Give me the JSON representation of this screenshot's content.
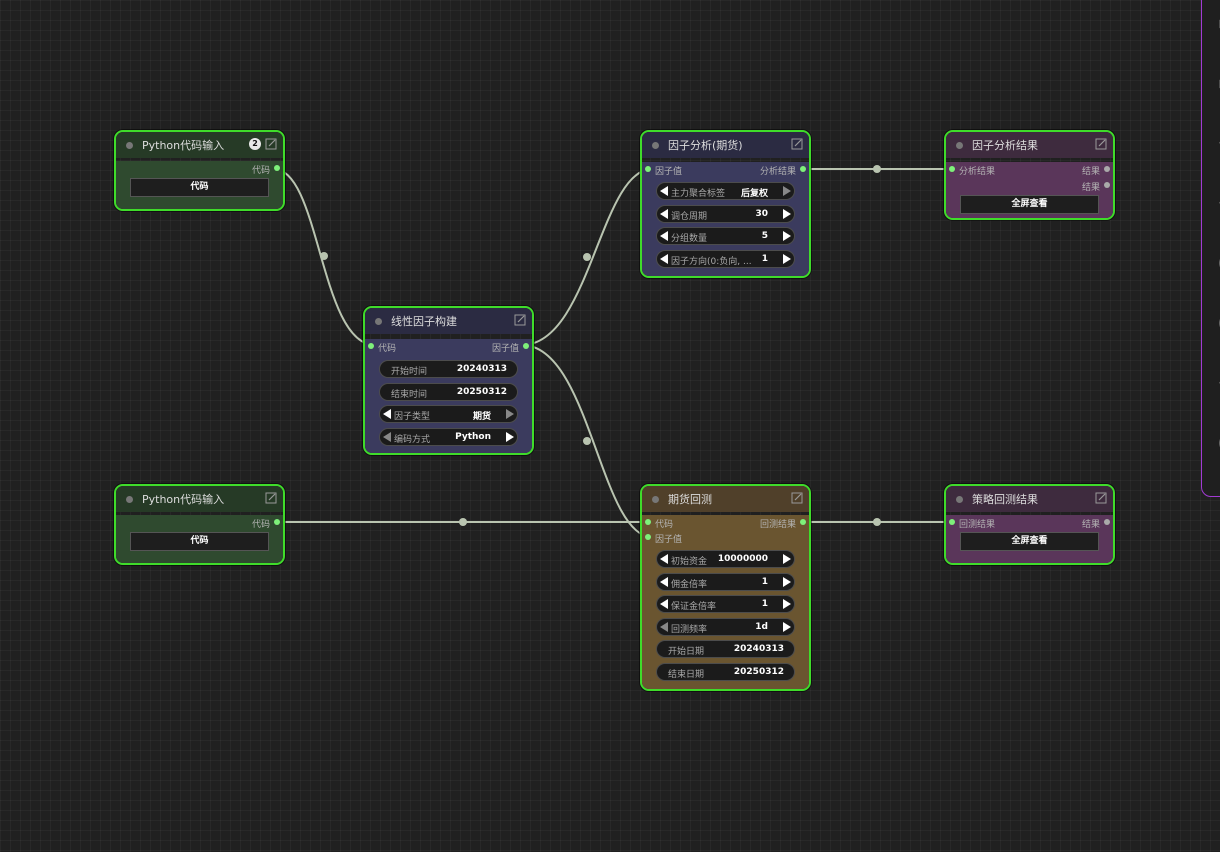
{
  "nodes": {
    "python_input_1": {
      "title": "Python代码输入",
      "badge": "2",
      "output": "代码",
      "button": "代码"
    },
    "python_input_2": {
      "title": "Python代码输入",
      "output": "代码",
      "button": "代码"
    },
    "linear_factor": {
      "title": "线性因子构建",
      "input": "代码",
      "output": "因子值",
      "widgets": [
        {
          "label": "开始时间",
          "value": "20240313"
        },
        {
          "label": "结束时间",
          "value": "20250312"
        },
        {
          "label": "因子类型",
          "value": "期货"
        },
        {
          "label": "编码方式",
          "value": "Python"
        }
      ]
    },
    "factor_analysis": {
      "title": "因子分析(期货)",
      "input": "因子值",
      "output": "分析结果",
      "widgets": [
        {
          "label": "主力聚合标签",
          "value": "后复权"
        },
        {
          "label": "调仓周期",
          "value": "30"
        },
        {
          "label": "分组数量",
          "value": "5"
        },
        {
          "label": "因子方向(0:负向, ...",
          "value": "1"
        }
      ]
    },
    "factor_result": {
      "title": "因子分析结果",
      "input": "分析结果",
      "outputs": [
        "结果",
        "结果"
      ],
      "button": "全屏查看"
    },
    "futures_backtest": {
      "title": "期货回测",
      "inputs": [
        "代码",
        "因子值"
      ],
      "output": "回测结果",
      "widgets": [
        {
          "label": "初始资金",
          "value": "10000000"
        },
        {
          "label": "佣金倍率",
          "value": "1"
        },
        {
          "label": "保证金倍率",
          "value": "1"
        },
        {
          "label": "回测频率",
          "value": "1d"
        },
        {
          "label": "开始日期",
          "value": "20240313"
        },
        {
          "label": "结束日期",
          "value": "20250312"
        }
      ]
    },
    "strategy_result": {
      "title": "策略回测结果",
      "input": "回测结果",
      "output": "结果",
      "button": "全屏查看"
    }
  },
  "colors": {
    "selected_border": "#3fdc2a",
    "wire": "#b9c4b0",
    "slot_connected": "#7ef07a",
    "side_panel_border": "#a23ad4"
  }
}
